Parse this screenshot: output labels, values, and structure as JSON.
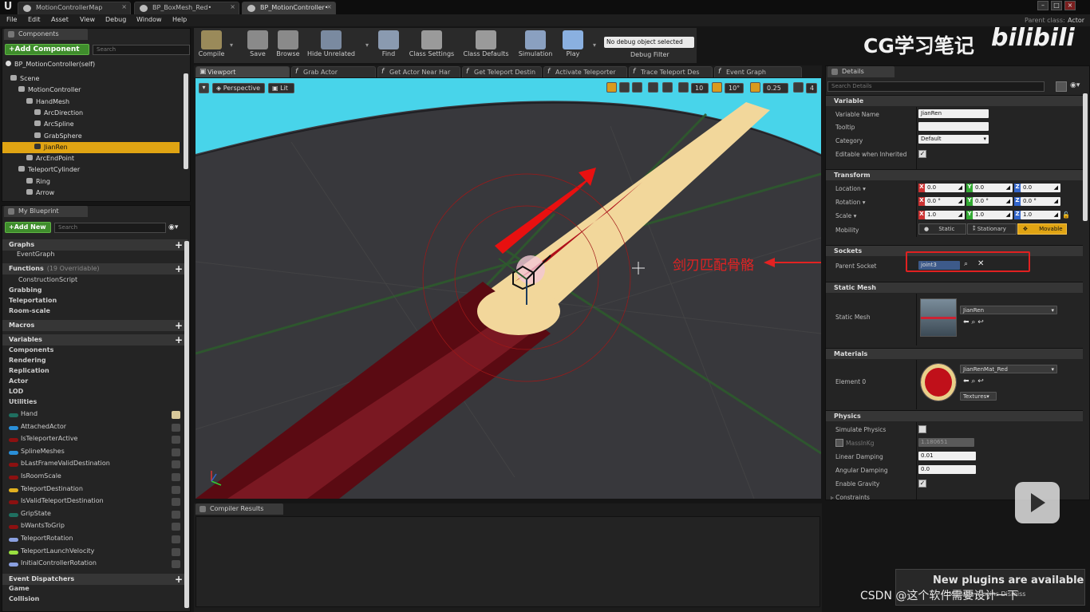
{
  "tabs": [
    "MotionControllerMap",
    "BP_BoxMesh_Red•",
    "BP_MotionController•"
  ],
  "menu": [
    "File",
    "Edit",
    "Asset",
    "View",
    "Debug",
    "Window",
    "Help"
  ],
  "parent_class": {
    "label": "Parent class:",
    "value": "Actor"
  },
  "components_panel": {
    "title": "Components",
    "add_button": "+Add Component",
    "search_placeholder": "Search",
    "root": "BP_MotionController(self)",
    "tree": [
      {
        "label": "Scene",
        "indent": 0
      },
      {
        "label": "MotionController",
        "indent": 1
      },
      {
        "label": "HandMesh",
        "indent": 2
      },
      {
        "label": "ArcDirection",
        "indent": 3
      },
      {
        "label": "ArcSpline",
        "indent": 3
      },
      {
        "label": "GrabSphere",
        "indent": 3
      },
      {
        "label": "JianRen",
        "indent": 3,
        "selected": true
      },
      {
        "label": "ArcEndPoint",
        "indent": 2
      },
      {
        "label": "TeleportCylinder",
        "indent": 1
      },
      {
        "label": "Ring",
        "indent": 2
      },
      {
        "label": "Arrow",
        "indent": 2
      }
    ]
  },
  "blueprint_panel": {
    "title": "My Blueprint",
    "add_button": "+Add New",
    "search_placeholder": "Search",
    "graphs_label": "Graphs",
    "graphs": [
      "EventGraph"
    ],
    "functions_label": "Functions",
    "functions_count": "(19 Overridable)",
    "functions": [
      "ConstructionScript",
      "Grabbing",
      "Teleportation",
      "Room-scale"
    ],
    "macros_label": "Macros",
    "variables_label": "Variables",
    "categories": [
      "Components",
      "Rendering",
      "Replication",
      "Actor",
      "LOD",
      "Utilities"
    ],
    "variables": [
      {
        "name": "Hand",
        "color": "#1f6f60"
      },
      {
        "name": "AttachedActor",
        "color": "#2a8fd8"
      },
      {
        "name": "IsTeleporterActive",
        "color": "#8c1111"
      },
      {
        "name": "SplineMeshes",
        "color": "#2a8fd8"
      },
      {
        "name": "bLastFrameValidDestination",
        "color": "#8c1111"
      },
      {
        "name": "IsRoomScale",
        "color": "#8c1111"
      },
      {
        "name": "TeleportDestination",
        "color": "#e0b020"
      },
      {
        "name": "IsValidTeleportDestination",
        "color": "#8c1111"
      },
      {
        "name": "GripState",
        "color": "#1f6f60"
      },
      {
        "name": "bWantsToGrip",
        "color": "#8c1111"
      },
      {
        "name": "TeleportRotation",
        "color": "#8aa0e0"
      },
      {
        "name": "TeleportLaunchVelocity",
        "color": "#9ae040"
      },
      {
        "name": "InitialControllerRotation",
        "color": "#8aa0e0"
      }
    ],
    "dispatchers_label": "Event Dispatchers",
    "dispatcher_categories": [
      "Game",
      "Collision"
    ]
  },
  "toolbar": [
    {
      "label": "Compile",
      "color": "#9a8a5a"
    },
    {
      "label": "Save",
      "color": "#8a8a8a"
    },
    {
      "label": "Browse",
      "color": "#8a8a8a"
    },
    {
      "label": "Hide Unrelated",
      "color": "#7a8aa0"
    },
    {
      "label": "Find",
      "color": "#8a9ab0"
    },
    {
      "label": "Class Settings",
      "color": "#9a9a9a"
    },
    {
      "label": "Class Defaults",
      "color": "#9a9a9a"
    },
    {
      "label": "Simulation",
      "color": "#8aa0c0"
    },
    {
      "label": "Play",
      "color": "#8ab0e0"
    }
  ],
  "debug": {
    "selected": "No debug object selected",
    "label": "Debug Filter"
  },
  "watermark": {
    "text": "CG学习笔记",
    "logo": "bilibili"
  },
  "viewport_tabs": [
    "Viewport",
    "Grab Actor",
    "Get Actor Near Har",
    "Get Teleport Destin",
    "Activate Teleporter",
    "Trace Teleport Des",
    "Event Graph"
  ],
  "viewport": {
    "perspective": "Perspective",
    "lit": "Lit",
    "grid_snap": "10",
    "rot_snap": "10°",
    "scale_snap": "0.25",
    "cam_speed": "4",
    "annotation": "剑刃匹配骨骼"
  },
  "details": {
    "title": "Details",
    "search_placeholder": "Search Details",
    "variable": {
      "section": "Variable",
      "name_label": "Variable Name",
      "name": "JianRen",
      "tooltip_label": "Tooltip",
      "tooltip": "",
      "category_label": "Category",
      "category": "Default",
      "editable_label": "Editable when Inherited"
    },
    "transform": {
      "section": "Transform",
      "location_label": "Location",
      "location": [
        "0.0",
        "0.0",
        "0.0"
      ],
      "rotation_label": "Rotation",
      "rotation": [
        "0.0 °",
        "0.0 °",
        "0.0 °"
      ],
      "scale_label": "Scale",
      "scale": [
        "1.0",
        "1.0",
        "1.0"
      ],
      "mobility_label": "Mobility",
      "mobility": [
        "Static",
        "Stationary",
        "Movable"
      ]
    },
    "sockets": {
      "section": "Sockets",
      "parent_label": "Parent Socket",
      "parent": "joint3"
    },
    "static_mesh": {
      "section": "Static Mesh",
      "label": "Static Mesh",
      "value": "JianRen"
    },
    "materials": {
      "section": "Materials",
      "label": "Element 0",
      "value": "JianRenMat_Red",
      "textures": "Textures"
    },
    "physics": {
      "section": "Physics",
      "simulate_label": "Simulate Physics",
      "mass_label": "MassInKg",
      "mass": "1.180651",
      "linear_label": "Linear Damping",
      "linear": "0.01",
      "angular_label": "Angular Damping",
      "angular": "0.0",
      "gravity_label": "Enable Gravity",
      "constraints_label": "Constraints"
    }
  },
  "compiler": {
    "title": "Compiler Results"
  },
  "notification": {
    "text": "New plugins are available",
    "sub": "Manage Plugins  Dismiss"
  },
  "csdn": "CSDN @这个软件需要设计一下"
}
